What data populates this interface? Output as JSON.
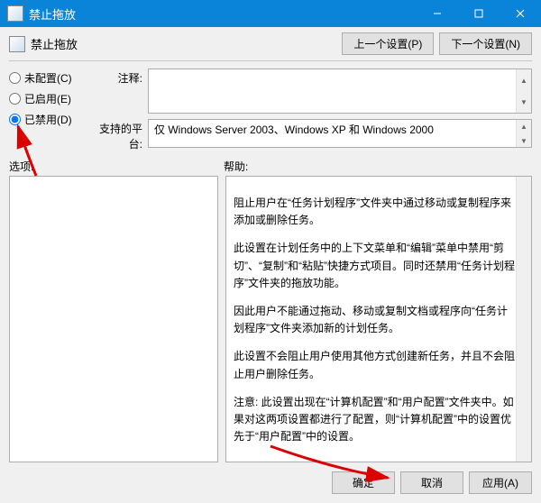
{
  "window": {
    "title": "禁止拖放"
  },
  "header": {
    "title": "禁止拖放",
    "prev_btn": "上一个设置(P)",
    "next_btn": "下一个设置(N)"
  },
  "radios": {
    "not_configured": "未配置(C)",
    "enabled": "已启用(E)",
    "disabled": "已禁用(D)"
  },
  "fields": {
    "comment_label": "注释:",
    "platform_label": "支持的平台:",
    "platform_value": "仅 Windows Server 2003、Windows XP 和 Windows 2000"
  },
  "section": {
    "options_label": "选项:",
    "help_label": "帮助:"
  },
  "help_text": {
    "p1": "阻止用户在“任务计划程序”文件夹中通过移动或复制程序来添加或删除任务。",
    "p2": "此设置在计划任务中的上下文菜单和“编辑”菜单中禁用“剪切”、“复制”和“粘贴”快捷方式项目。同时还禁用“任务计划程序”文件夹的拖放功能。",
    "p3": "因此用户不能通过拖动、移动或复制文档或程序向“任务计划程序”文件夹添加新的计划任务。",
    "p4": "此设置不会阻止用户使用其他方式创建新任务，并且不会阻止用户删除任务。",
    "p5": "注意: 此设置出现在“计算机配置”和“用户配置”文件夹中。如果对这两项设置都进行了配置，则“计算机配置”中的设置优先于“用户配置”中的设置。"
  },
  "footer": {
    "ok": "确定",
    "cancel": "取消",
    "apply": "应用(A)"
  }
}
